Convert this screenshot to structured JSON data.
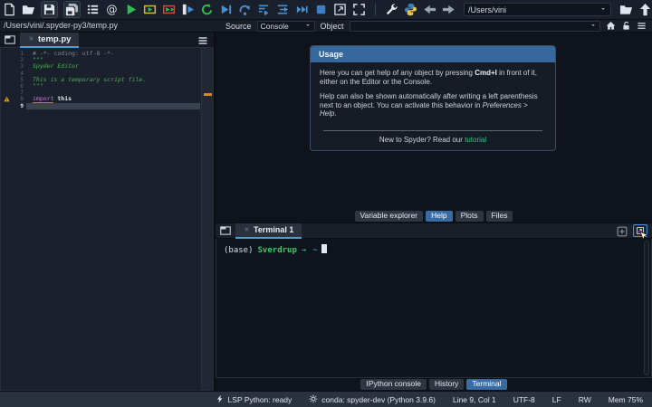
{
  "colors": {
    "accent_blue": "#3a6ca4",
    "tab_underline_blue": "#4d9fd8",
    "usage_header_blue": "#36689e",
    "link_green": "#2fbf86",
    "terminal_green": "#3fc368",
    "terminal_cyan": "#49b8c8",
    "warning_orange": "#e0a01c",
    "keyword_magenta": "#c678dd",
    "string_green": "#4fae58"
  },
  "toolbar": {
    "working_dir": "/Users/vini",
    "items": [
      {
        "icon": "new-file"
      },
      {
        "icon": "open-file"
      },
      {
        "icon": "save",
        "boxed": true
      },
      {
        "icon": "save-all",
        "boxed": true
      },
      {
        "icon": "outline-explorer"
      },
      {
        "icon": "find-symbols"
      },
      {
        "icon": "run"
      },
      {
        "icon": "run-cell"
      },
      {
        "icon": "run-cell-advance"
      },
      {
        "icon": "run-selection"
      },
      {
        "icon": "rerun-cell"
      },
      {
        "icon": "debug-file"
      },
      {
        "icon": "debug-step-over"
      },
      {
        "icon": "debug-step-into"
      },
      {
        "icon": "debug-step-out"
      },
      {
        "icon": "debug-continue"
      },
      {
        "icon": "debug-stop"
      },
      {
        "icon": "maximize-pane"
      },
      {
        "icon": "fullscreen"
      },
      {
        "sep": true
      },
      {
        "icon": "preferences"
      },
      {
        "icon": "python-path"
      },
      {
        "icon": "back"
      },
      {
        "icon": "forward"
      },
      {
        "combo": true
      },
      {
        "icon": "open-directory"
      },
      {
        "icon": "up-directory"
      }
    ]
  },
  "editor": {
    "breadcrumb": "/Users/vini/.spyder-py3/temp.py",
    "tab": "temp.py",
    "lines": [
      {
        "n": 1,
        "segments": [
          {
            "t": "# -*- coding: utf-8 -*-",
            "c": "comment"
          }
        ]
      },
      {
        "n": 2,
        "segments": [
          {
            "t": "\"\"\"",
            "c": "string"
          }
        ]
      },
      {
        "n": 3,
        "segments": [
          {
            "t": "Spyder Editor",
            "c": "string-i"
          }
        ]
      },
      {
        "n": 4,
        "segments": []
      },
      {
        "n": 5,
        "segments": [
          {
            "t": "This is a temporary script file.",
            "c": "string-i"
          }
        ]
      },
      {
        "n": 6,
        "segments": [
          {
            "t": "\"\"\"",
            "c": "string"
          }
        ]
      },
      {
        "n": 7,
        "segments": []
      },
      {
        "n": 8,
        "warning": true,
        "segments": [
          {
            "t": "import",
            "c": "keyword"
          },
          {
            "t": " this",
            "c": "plain"
          }
        ]
      },
      {
        "n": 9,
        "current": true,
        "segments": []
      }
    ]
  },
  "help": {
    "source_label": "Source",
    "source_value": "Console",
    "object_label": "Object",
    "object_value": "",
    "usage": {
      "title": "Usage",
      "p1_pre": "Here you can get help of any object by pressing ",
      "p1_kbd": "Cmd+I",
      "p1_post": " in front of it, either on the Editor or the Console.",
      "p2_pre": "Help can also be shown automatically after writing a left parenthesis next to an object. You can activate this behavior in ",
      "p2_em": "Preferences > Help",
      "p2_post": ".",
      "footer_pre": "New to Spyder? Read our ",
      "footer_link": "tutorial"
    }
  },
  "panel_tabs": [
    {
      "label": "Variable explorer",
      "active": false
    },
    {
      "label": "Help",
      "active": true
    },
    {
      "label": "Plots",
      "active": false
    },
    {
      "label": "Files",
      "active": false
    }
  ],
  "terminal": {
    "tab": "Terminal 1",
    "prompt": {
      "env": "(base)",
      "host": "Sverdrup",
      "arrow": "→",
      "path": "~"
    }
  },
  "bottom_tabs": [
    {
      "label": "IPython console",
      "active": false
    },
    {
      "label": "History",
      "active": false
    },
    {
      "label": "Terminal",
      "active": true
    }
  ],
  "statusbar": {
    "lsp": "LSP Python: ready",
    "conda": "conda: spyder-dev (Python 3.9.6)",
    "cursor": "Line 9, Col 1",
    "encoding": "UTF-8",
    "eol": "LF",
    "rw": "RW",
    "mem": "Mem 75%"
  }
}
